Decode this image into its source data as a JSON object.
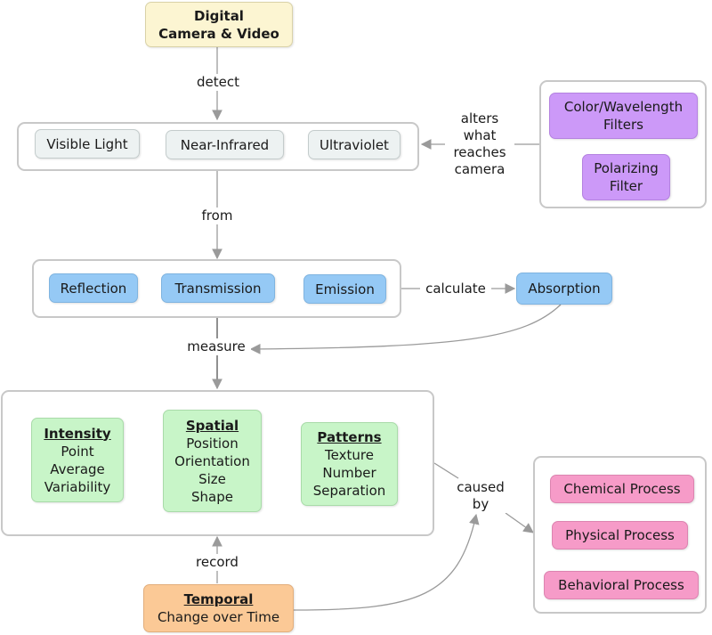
{
  "diagram": {
    "camera": {
      "line1": "Digital",
      "line2": "Camera & Video"
    },
    "light_types": [
      "Visible Light",
      "Near-Infrared",
      "Ultraviolet"
    ],
    "filters": [
      {
        "line1": "Color/Wavelength",
        "line2": "Filters"
      },
      {
        "line1": "Polarizing",
        "line2": "Filter"
      }
    ],
    "interactions": [
      "Reflection",
      "Transmission",
      "Emission"
    ],
    "absorption": "Absorption",
    "measures": [
      {
        "heading": "Intensity",
        "items": [
          "Point",
          "Average",
          "Variability"
        ]
      },
      {
        "heading": "Spatial",
        "items": [
          "Position",
          "Orientation",
          "Size",
          "Shape"
        ]
      },
      {
        "heading": "Patterns",
        "items": [
          "Texture",
          "Number",
          "Separation"
        ]
      }
    ],
    "temporal": {
      "heading": "Temporal",
      "text": "Change over Time"
    },
    "processes": [
      "Chemical Process",
      "Physical Process",
      "Behavioral Process"
    ],
    "links": {
      "detect": "detect",
      "alters": [
        "alters",
        "what",
        "reaches",
        "camera"
      ],
      "from": "from",
      "calculate": "calculate",
      "measure": "measure",
      "record": "record",
      "caused_by": [
        "caused",
        "by"
      ]
    },
    "colors": {
      "camera": "#fcf5d2",
      "light": "#edf2f2",
      "interaction": "#95c9f5",
      "filter": "#cc99f8",
      "measure": "#c8f5c8",
      "process": "#f69bc8",
      "temporal": "#fbc996",
      "link": "#9a9a9a"
    }
  }
}
